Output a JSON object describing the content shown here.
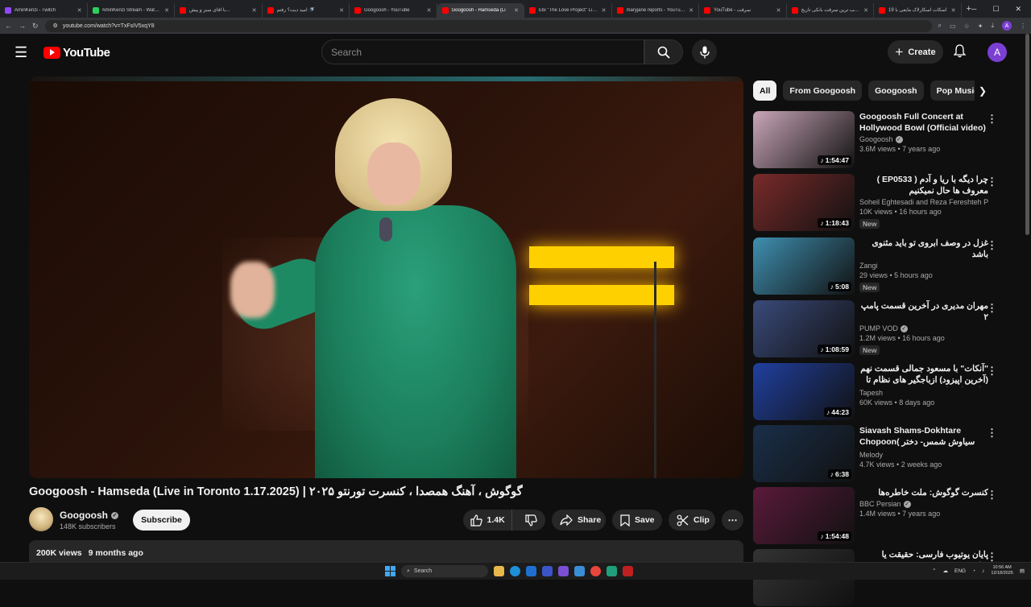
{
  "browser": {
    "tabs": [
      {
        "label": "AminKenzi - Twitch",
        "color": "#9147ff",
        "active": false
      },
      {
        "label": "AminKenzi Stream - Watch Li",
        "color": "#2bd15c",
        "active": false
      },
      {
        "label": "با آقای سبز و پیش...",
        "color": "#ff0000",
        "active": false
      },
      {
        "label": "امید دیت؟ رفتم 🚿",
        "color": "#ff0000",
        "active": false
      },
      {
        "label": "Googoosh - YouTube",
        "color": "#ff0000",
        "active": false
      },
      {
        "label": "Googoosh - Hamseda (Li",
        "color": "#ff0000",
        "active": true
      },
      {
        "label": "Ebi \"The Love Project\" Live In",
        "color": "#ff0000",
        "active": false
      },
      {
        "label": "maryjane reports - YouTube",
        "color": "#ff0000",
        "active": false
      },
      {
        "label": "YouTube - سرقت",
        "color": "#ff0000",
        "active": false
      },
      {
        "label": "عجیب ترین سرقت بانکی تاریخ",
        "color": "#ff0000",
        "active": false
      },
      {
        "label": "اسکات اسکارلاک مایعی با 19",
        "color": "#ff0000",
        "active": false
      }
    ],
    "url": "youtube.com/watch?v=TxFsIV5xqY8"
  },
  "header": {
    "logo_text": "YouTube",
    "search_placeholder": "Search",
    "create_label": "Create",
    "avatar_letter": "A"
  },
  "video": {
    "title": "Googoosh - Hamseda (Live in Toronto 1.17.2025) | گوگوش ، آهنگ همصدا ، کنسرت تورنتو ۲۰۲۵",
    "channel": "Googoosh",
    "subscribers": "148K subscribers",
    "subscribe_label": "Subscribe",
    "likes": "1.4K",
    "share_label": "Share",
    "save_label": "Save",
    "clip_label": "Clip",
    "views": "200K views",
    "age": "9 months ago"
  },
  "chips": [
    "All",
    "From Googoosh",
    "Googoosh",
    "Pop Music"
  ],
  "recommendations": [
    {
      "title": "Googoosh Full Concert at Hollywood Bowl (Official video)",
      "rtl": false,
      "channel": "Googoosh",
      "verified": true,
      "views": "3.6M views",
      "age": "7 years ago",
      "duration": "1:54:47",
      "badge": "",
      "thumb": "#c9a6b8"
    },
    {
      "title": "چرا دیگه با ریا و آدم ( EP0533 ) معروف ها حال نمیکنیم",
      "rtl": true,
      "channel": "Soheil Eghtesadi and Reza Fereshteh PL...",
      "verified": false,
      "views": "10K views",
      "age": "16 hours ago",
      "duration": "1:18:43",
      "badge": "New",
      "thumb": "#7a2a2a"
    },
    {
      "title": "غزل در وصف ابروی تو باید مثنوی باشد",
      "rtl": true,
      "channel": "Zangi",
      "verified": false,
      "views": "29 views",
      "age": "5 hours ago",
      "duration": "5:08",
      "badge": "New",
      "thumb": "#3f8fb0"
    },
    {
      "title": "مهران مدیری در آخرین قسمت پامپ ۲",
      "rtl": true,
      "channel": "PUMP VOD",
      "verified": true,
      "views": "1.2M views",
      "age": "16 hours ago",
      "duration": "1:08:59",
      "badge": "New",
      "thumb": "#3a4a7a"
    },
    {
      "title": "\"آنکات\" با مسعود جمالی قسمت نهم (آخرین اپیزود) ازباجگیر های نظام تا سلبیخهای قلم",
      "rtl": true,
      "channel": "Tapesh",
      "verified": false,
      "views": "60K views",
      "age": "8 days ago",
      "duration": "44:23",
      "badge": "",
      "thumb": "#2040a0"
    },
    {
      "title": "Siavash Shams-Dokhtare Chopoon( سیاوش شمس- دختر چوپون",
      "rtl": false,
      "channel": "Melody",
      "verified": false,
      "views": "4.7K views",
      "age": "2 weeks ago",
      "duration": "6:38",
      "badge": "",
      "thumb": "#1a2f4a"
    },
    {
      "title": "کنسرت گوگوش: ملت خاطره‌ها",
      "rtl": true,
      "channel": "BBC Persian",
      "verified": true,
      "views": "1.4M views",
      "age": "7 years ago",
      "duration": "1:54:48",
      "badge": "",
      "thumb": "#5a1a3a"
    },
    {
      "title": "پایان یوتیوب فارسی: حقیقت یا هیاهو؟",
      "rtl": true,
      "channel": "",
      "verified": false,
      "views": "",
      "age": "",
      "duration": "",
      "badge": "",
      "thumb": "#333333"
    }
  ],
  "taskbar": {
    "search_label": "Search",
    "lang": "ENG",
    "time": "10:56 AM",
    "date": "12/18/2025"
  }
}
